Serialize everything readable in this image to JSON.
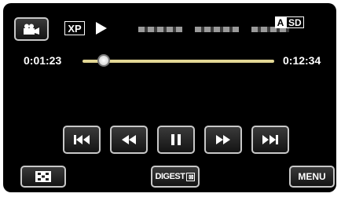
{
  "top_bar": {
    "mode_icon": "camcorder-icon",
    "quality": "XP",
    "play_state_icon": "play-icon",
    "media": {
      "a": "A",
      "sd": "SD"
    }
  },
  "timeline": {
    "elapsed": "0:01:23",
    "total": "0:12:34",
    "progress": 0.11
  },
  "controls": [
    "skip-back-icon",
    "rewind-icon",
    "pause-icon",
    "fast-forward-icon",
    "skip-forward-icon"
  ],
  "bottom_bar": {
    "thumbnail_icon": "index-grid-icon",
    "digest_label": "DIGEST",
    "digest_mark": "⊠",
    "menu_label": "MENU"
  }
}
